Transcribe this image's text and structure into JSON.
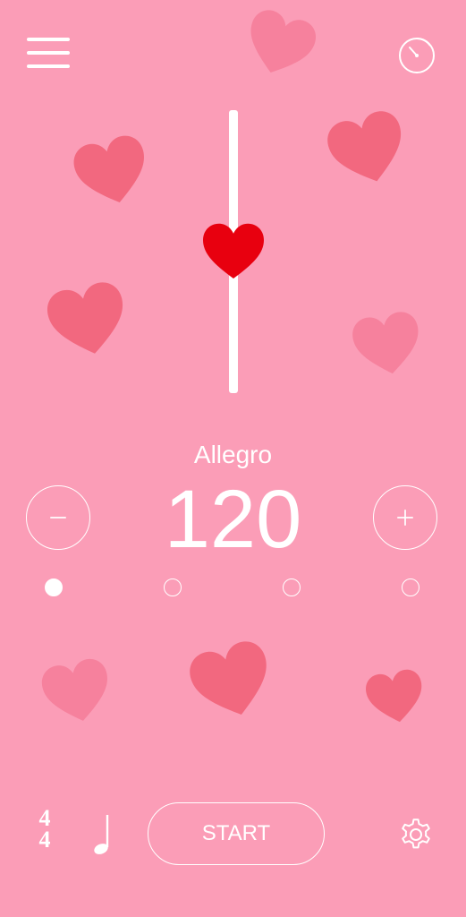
{
  "tempo": {
    "name": "Allegro",
    "bpm": "120"
  },
  "controls": {
    "minus_symbol": "−",
    "plus_symbol": "+",
    "start_label": "START"
  },
  "time_signature": {
    "top": "4",
    "bottom": "4"
  },
  "beat_dots": [
    {
      "filled": true
    },
    {
      "filled": false
    },
    {
      "filled": false
    },
    {
      "filled": false
    }
  ],
  "icons": {
    "menu": "hamburger-menu-icon",
    "timer": "stopwatch-icon",
    "note": "quarter-note-icon",
    "settings": "gear-icon",
    "pendulum": "heart-icon"
  },
  "colors": {
    "background": "#fb9db7",
    "heart_light": "#f6819d",
    "heart_dark": "#f2687f",
    "pendulum_heart": "#e8000f",
    "foreground": "#ffffff"
  }
}
